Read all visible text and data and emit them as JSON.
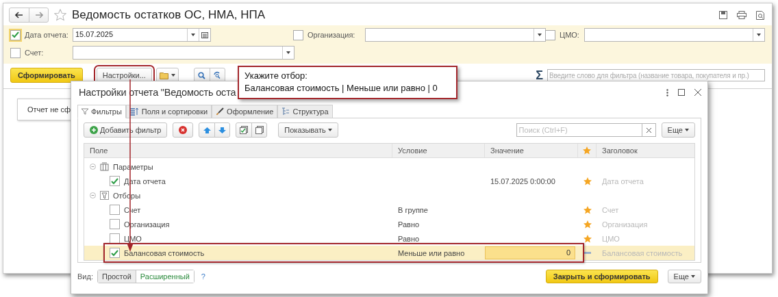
{
  "window": {
    "title": "Ведомость остатков ОС, НМА, НПА"
  },
  "filters": [
    {
      "label": "Дата отчета:",
      "checked": true,
      "value": "15.07.2025",
      "kind": "date"
    },
    {
      "label": "Организация:",
      "checked": false,
      "kind": "select"
    },
    {
      "label": "ЦМО:",
      "checked": false,
      "kind": "select"
    },
    {
      "label": "Счет:",
      "checked": false,
      "kind": "select"
    }
  ],
  "toolbar": {
    "generate_button": "Сформировать",
    "settings_button": "Настройки...",
    "sum_sign": "Σ",
    "search_placeholder": "Введите слово для фильтра (название товара, покупателя и пр.)"
  },
  "report": {
    "message": "Отчет не сф"
  },
  "dialog": {
    "title": "Настройки отчета \"Ведомость оста",
    "tabs": [
      {
        "label": "Фильтры",
        "selected": true
      },
      {
        "label": "Поля и сортировки",
        "selected": false
      },
      {
        "label": "Оформление",
        "selected": false
      },
      {
        "label": "Структура",
        "selected": false
      }
    ],
    "add_filter_button": "Добавить фильтр",
    "show_button": "Показывать",
    "search_placeholder": "Поиск (Ctrl+F)",
    "more_button": "Еще",
    "columns": [
      "Поле",
      "Условие",
      "Значение",
      "Заголовок"
    ],
    "groups": [
      {
        "name": "Параметры",
        "kind": "params",
        "expanded": true,
        "children": [
          {
            "field": "Дата отчета",
            "checked": true,
            "value": "15.07.2025 0:00:00",
            "title": "Дата отчета",
            "starred": true,
            "selected": false
          }
        ]
      },
      {
        "name": "Отборы",
        "kind": "filters",
        "expanded": true,
        "children": [
          {
            "field": "Счет",
            "checked": false,
            "condition": "В группе",
            "title": "Счет",
            "starred": true,
            "selected": false
          },
          {
            "field": "Организация",
            "checked": false,
            "condition": "Равно",
            "title": "Организация",
            "starred": true,
            "selected": false
          },
          {
            "field": "ЦМО",
            "checked": false,
            "condition": "Равно",
            "title": "ЦМО",
            "starred": true,
            "selected": false
          },
          {
            "field": "Балансовая стоимость",
            "checked": true,
            "condition": "Меньше или равно",
            "value": "0",
            "title": "Балансовая стоимость",
            "starred": false,
            "selected": true
          }
        ]
      }
    ],
    "view_label": "Вид:",
    "view_options": [
      {
        "label": "Простой",
        "selected": false
      },
      {
        "label": "Расширенный",
        "selected": true
      }
    ],
    "help": "?",
    "submit_button": "Закрыть и сформировать",
    "footer_more_button": "Еще"
  },
  "callout": {
    "title": "Укажите отбор:",
    "text": "Балансовая стоимость | Меньше или равно | 0"
  }
}
